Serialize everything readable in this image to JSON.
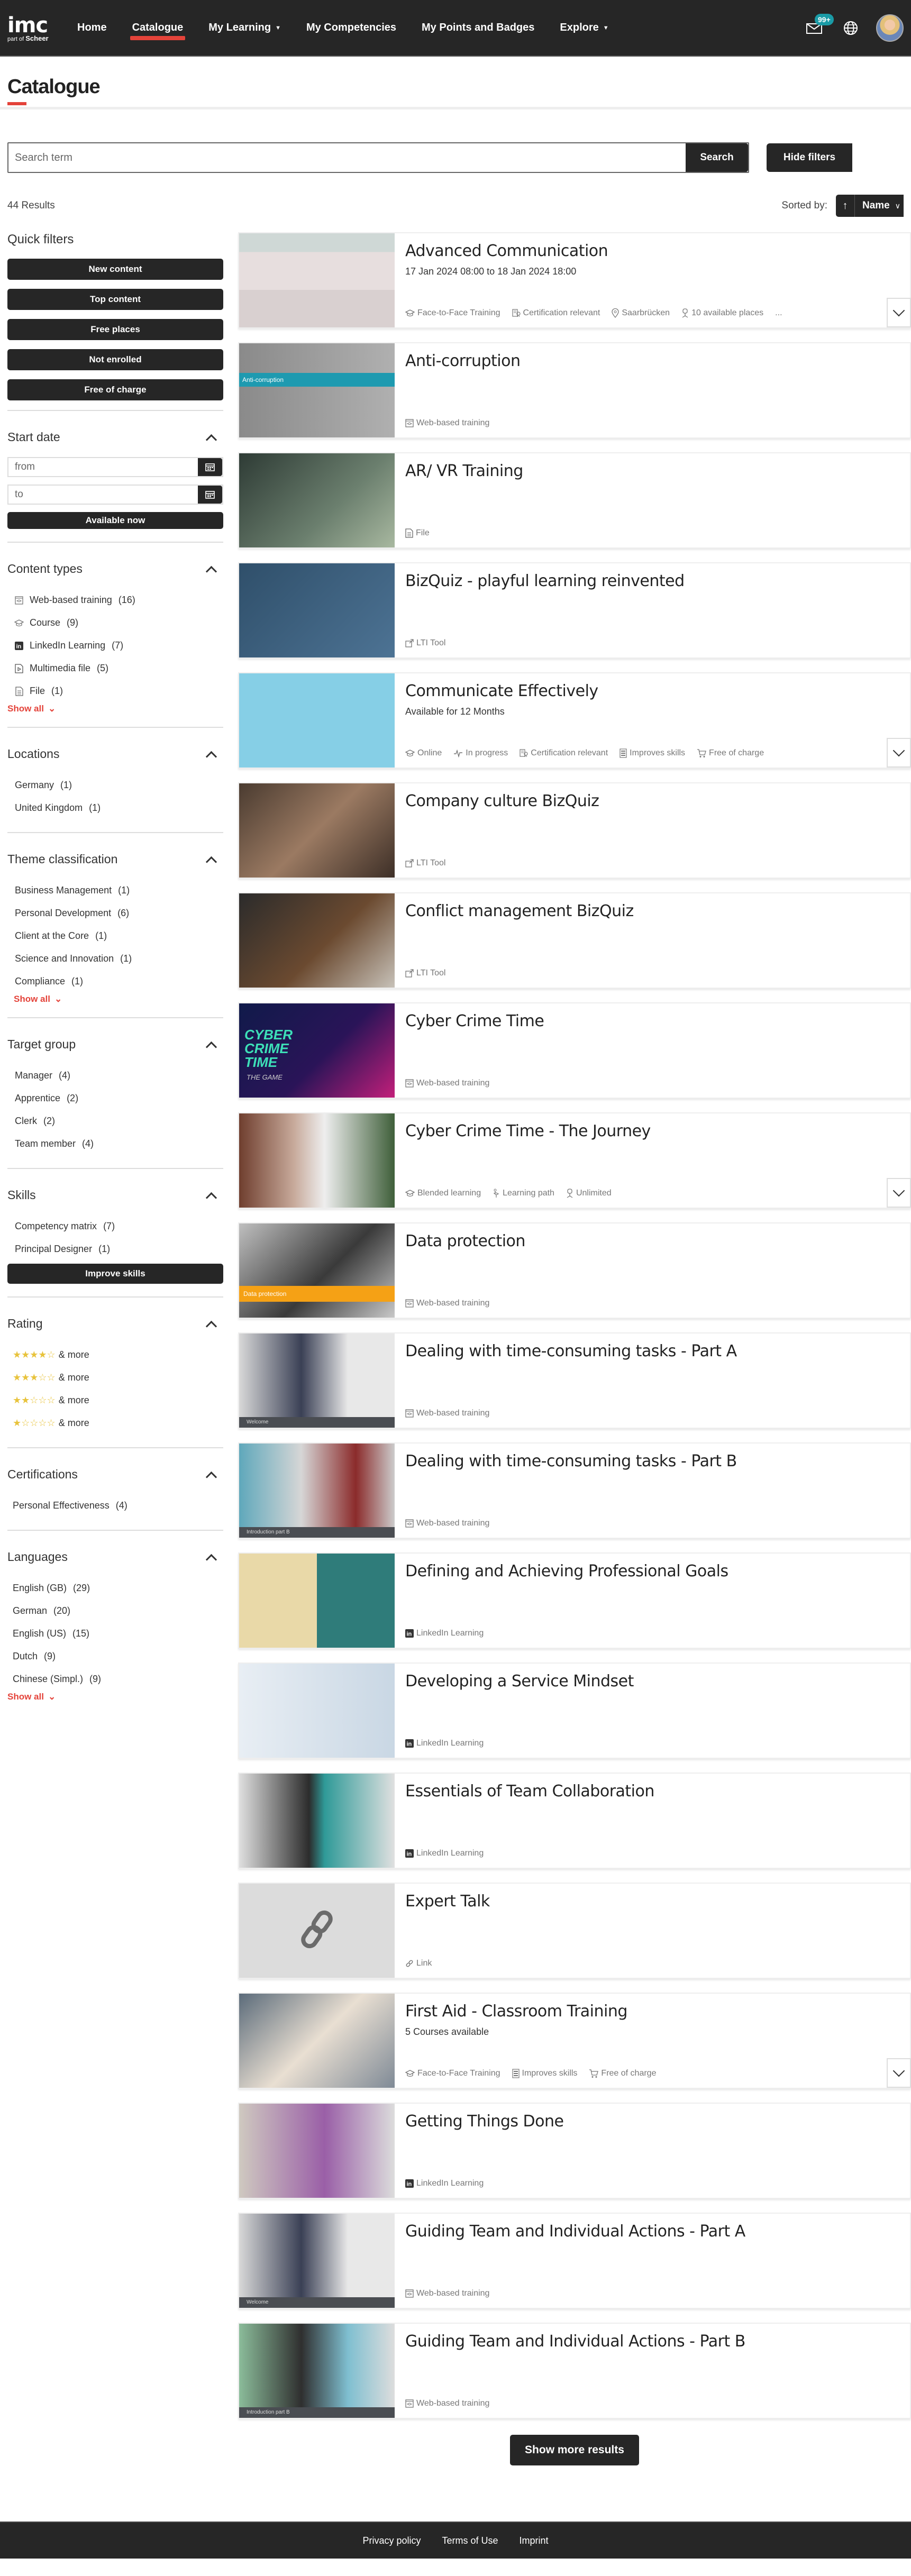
{
  "nav": {
    "logo_main": "imc",
    "logo_sub_prefix": "part of",
    "logo_sub_brand": "Scheer",
    "items": [
      {
        "label": "Home",
        "active": false,
        "dropdown": false
      },
      {
        "label": "Catalogue",
        "active": true,
        "dropdown": false
      },
      {
        "label": "My Learning",
        "active": false,
        "dropdown": true
      },
      {
        "label": "My Competencies",
        "active": false,
        "dropdown": false
      },
      {
        "label": "My Points and Badges",
        "active": false,
        "dropdown": false
      },
      {
        "label": "Explore",
        "active": false,
        "dropdown": true
      }
    ],
    "messages_badge": "99+",
    "accent_color": "#e4433a",
    "badge_color": "#1a9ba6"
  },
  "page": {
    "title": "Catalogue"
  },
  "search": {
    "placeholder": "Search term",
    "value": "",
    "button_label": "Search",
    "hide_filters_label": "Hide filters"
  },
  "results": {
    "count_label": "44 Results",
    "sorted_by_label": "Sorted by:",
    "sort_value": "Name",
    "sort_direction": "ascending",
    "show_more_label": "Show more results"
  },
  "filters": {
    "quick_filters_title": "Quick filters",
    "quick_filters": [
      "New content",
      "Top content",
      "Free places",
      "Not enrolled",
      "Free of charge"
    ],
    "start_date": {
      "title": "Start date",
      "from_placeholder": "from",
      "to_placeholder": "to",
      "available_now_label": "Available now"
    },
    "content_types": {
      "title": "Content types",
      "items": [
        {
          "label": "Web-based training",
          "count": "(16)",
          "icon": "wbt-icon"
        },
        {
          "label": "Course",
          "count": "(9)",
          "icon": "graduation-cap-icon"
        },
        {
          "label": "LinkedIn Learning",
          "count": "(7)",
          "icon": "linkedin-icon"
        },
        {
          "label": "Multimedia file",
          "count": "(5)",
          "icon": "multimedia-file-icon"
        },
        {
          "label": "File",
          "count": "(1)",
          "icon": "file-icon"
        }
      ],
      "show_all_label": "Show all"
    },
    "locations": {
      "title": "Locations",
      "items": [
        {
          "label": "Germany",
          "count": "(1)"
        },
        {
          "label": "United Kingdom",
          "count": "(1)"
        }
      ]
    },
    "theme_classification": {
      "title": "Theme classification",
      "items": [
        {
          "label": "Business Management",
          "count": "(1)"
        },
        {
          "label": "Personal Development",
          "count": "(6)"
        },
        {
          "label": "Client at the Core",
          "count": "(1)"
        },
        {
          "label": "Science and Innovation",
          "count": "(1)"
        },
        {
          "label": "Compliance",
          "count": "(1)"
        }
      ],
      "show_all_label": "Show all"
    },
    "target_group": {
      "title": "Target group",
      "items": [
        {
          "label": "Manager",
          "count": "(4)"
        },
        {
          "label": "Apprentice",
          "count": "(2)"
        },
        {
          "label": "Clerk",
          "count": "(2)"
        },
        {
          "label": "Team member",
          "count": "(4)"
        }
      ]
    },
    "skills": {
      "title": "Skills",
      "items": [
        {
          "label": "Competency matrix",
          "count": "(7)"
        },
        {
          "label": "Principal Designer",
          "count": "(1)"
        }
      ],
      "improve_label": "Improve skills"
    },
    "rating": {
      "title": "Rating",
      "items": [
        {
          "stars": 4,
          "max": 5,
          "label": "& more"
        },
        {
          "stars": 3,
          "max": 5,
          "label": "& more"
        },
        {
          "stars": 2,
          "max": 5,
          "label": "& more"
        },
        {
          "stars": 1,
          "max": 5,
          "label": "& more"
        }
      ],
      "star_color": "#e8c33c"
    },
    "certifications": {
      "title": "Certifications",
      "items": [
        {
          "label": "Personal Effectiveness",
          "count": "(4)"
        }
      ]
    },
    "languages": {
      "title": "Languages",
      "items": [
        {
          "label": "English (GB)",
          "count": "(29)"
        },
        {
          "label": "German",
          "count": "(20)"
        },
        {
          "label": "English (US)",
          "count": "(15)"
        },
        {
          "label": "Dutch",
          "count": "(9)"
        },
        {
          "label": "Chinese (Simpl.)",
          "count": "(9)"
        }
      ],
      "show_all_label": "Show all"
    }
  },
  "cards": [
    {
      "title": "Advanced Communication",
      "subtitle": "17 Jan 2024 08:00 to 18 Jan 2024 18:00",
      "thumb": "office-people",
      "expandable": true,
      "tags": [
        {
          "icon": "graduation-cap-icon",
          "label": "Face-to-Face Training"
        },
        {
          "icon": "certificate-icon",
          "label": "Certification relevant"
        },
        {
          "icon": "location-pin-icon",
          "label": "Saarbrücken"
        },
        {
          "icon": "chair-icon",
          "label": "10 available places"
        },
        {
          "icon": "more-icon",
          "label": "..."
        }
      ]
    },
    {
      "title": "Anti-corruption",
      "subtitle": "",
      "thumb": "anti-corruption",
      "thumb_caption": "Anti-corruption",
      "expandable": false,
      "tags": [
        {
          "icon": "wbt-icon",
          "label": "Web-based training"
        }
      ]
    },
    {
      "title": "AR/ VR Training",
      "subtitle": "",
      "thumb": "vr",
      "expandable": false,
      "tags": [
        {
          "icon": "file-icon",
          "label": "File"
        }
      ]
    },
    {
      "title": "BizQuiz - playful learning reinvented",
      "subtitle": "",
      "thumb": "bizquiz",
      "expandable": false,
      "tags": [
        {
          "icon": "external-link-icon",
          "label": "LTI Tool"
        }
      ]
    },
    {
      "title": "Communicate Effectively",
      "subtitle": "Available for 12 Months",
      "thumb": "communicate",
      "expandable": true,
      "tags": [
        {
          "icon": "graduation-cap-icon",
          "label": "Online"
        },
        {
          "icon": "activity-icon",
          "label": "In progress"
        },
        {
          "icon": "certificate-icon",
          "label": "Certification relevant"
        },
        {
          "icon": "skills-icon",
          "label": "Improves skills"
        },
        {
          "icon": "cart-icon",
          "label": "Free of charge"
        }
      ]
    },
    {
      "title": "Company culture BizQuiz",
      "subtitle": "",
      "thumb": "handshake",
      "expandable": false,
      "tags": [
        {
          "icon": "external-link-icon",
          "label": "LTI Tool"
        }
      ]
    },
    {
      "title": "Conflict management BizQuiz",
      "subtitle": "",
      "thumb": "desk",
      "expandable": false,
      "tags": [
        {
          "icon": "external-link-icon",
          "label": "LTI Tool"
        }
      ]
    },
    {
      "title": "Cyber Crime Time",
      "subtitle": "",
      "thumb": "cyber",
      "thumb_caption": "CYBER CRIME TIME",
      "thumb_caption2": "THE GAME",
      "expandable": false,
      "tags": [
        {
          "icon": "wbt-icon",
          "label": "Web-based training"
        }
      ]
    },
    {
      "title": "Cyber Crime Time - The Journey",
      "subtitle": "",
      "thumb": "journey",
      "expandable": true,
      "tags": [
        {
          "icon": "graduation-cap-icon",
          "label": "Blended learning"
        },
        {
          "icon": "learning-path-icon",
          "label": "Learning path"
        },
        {
          "icon": "chair-icon",
          "label": "Unlimited"
        }
      ]
    },
    {
      "title": "Data protection",
      "subtitle": "",
      "thumb": "data-protection",
      "thumb_caption": "Data protection",
      "expandable": false,
      "tags": [
        {
          "icon": "wbt-icon",
          "label": "Web-based training"
        }
      ]
    },
    {
      "title": "Dealing with time-consuming tasks - Part A",
      "subtitle": "",
      "thumb": "wbt-grey",
      "thumb_caption": "Welcome",
      "expandable": false,
      "tags": [
        {
          "icon": "wbt-icon",
          "label": "Web-based training"
        }
      ]
    },
    {
      "title": "Dealing with time-consuming tasks - Part B",
      "subtitle": "",
      "thumb": "wbt-team",
      "thumb_caption": "Introduction part B",
      "expandable": false,
      "tags": [
        {
          "icon": "wbt-icon",
          "label": "Web-based training"
        }
      ]
    },
    {
      "title": "Defining and Achieving Professional Goals",
      "subtitle": "",
      "thumb": "goals",
      "expandable": false,
      "tags": [
        {
          "icon": "linkedin-icon",
          "label": "LinkedIn Learning"
        }
      ]
    },
    {
      "title": "Developing a Service Mindset",
      "subtitle": "",
      "thumb": "service",
      "expandable": false,
      "tags": [
        {
          "icon": "linkedin-icon",
          "label": "LinkedIn Learning"
        }
      ]
    },
    {
      "title": "Essentials of Team Collaboration",
      "subtitle": "",
      "thumb": "collab",
      "expandable": false,
      "tags": [
        {
          "icon": "linkedin-icon",
          "label": "LinkedIn Learning"
        }
      ]
    },
    {
      "title": "Expert Talk",
      "subtitle": "",
      "thumb": "link",
      "expandable": false,
      "tags": [
        {
          "icon": "link-icon",
          "label": "Link"
        }
      ]
    },
    {
      "title": "First Aid - Classroom Training",
      "subtitle": "5 Courses available",
      "thumb": "firstaid",
      "expandable": true,
      "tags": [
        {
          "icon": "graduation-cap-icon",
          "label": "Face-to-Face Training"
        },
        {
          "icon": "skills-icon",
          "label": "Improves skills"
        },
        {
          "icon": "cart-icon",
          "label": "Free of charge"
        }
      ]
    },
    {
      "title": "Getting Things Done",
      "subtitle": "",
      "thumb": "gtd",
      "expandable": false,
      "tags": [
        {
          "icon": "linkedin-icon",
          "label": "LinkedIn Learning"
        }
      ]
    },
    {
      "title": "Guiding Team and Individual Actions - Part A",
      "subtitle": "",
      "thumb": "wbt-grey",
      "thumb_caption": "Welcome",
      "expandable": false,
      "tags": [
        {
          "icon": "wbt-icon",
          "label": "Web-based training"
        }
      ]
    },
    {
      "title": "Guiding Team and Individual Actions - Part B",
      "subtitle": "",
      "thumb": "wbt-team2",
      "thumb_caption": "Introduction part B",
      "expandable": false,
      "tags": [
        {
          "icon": "wbt-icon",
          "label": "Web-based training"
        }
      ]
    }
  ],
  "footer": {
    "links": [
      "Privacy policy",
      "Terms of Use",
      "Imprint"
    ]
  }
}
